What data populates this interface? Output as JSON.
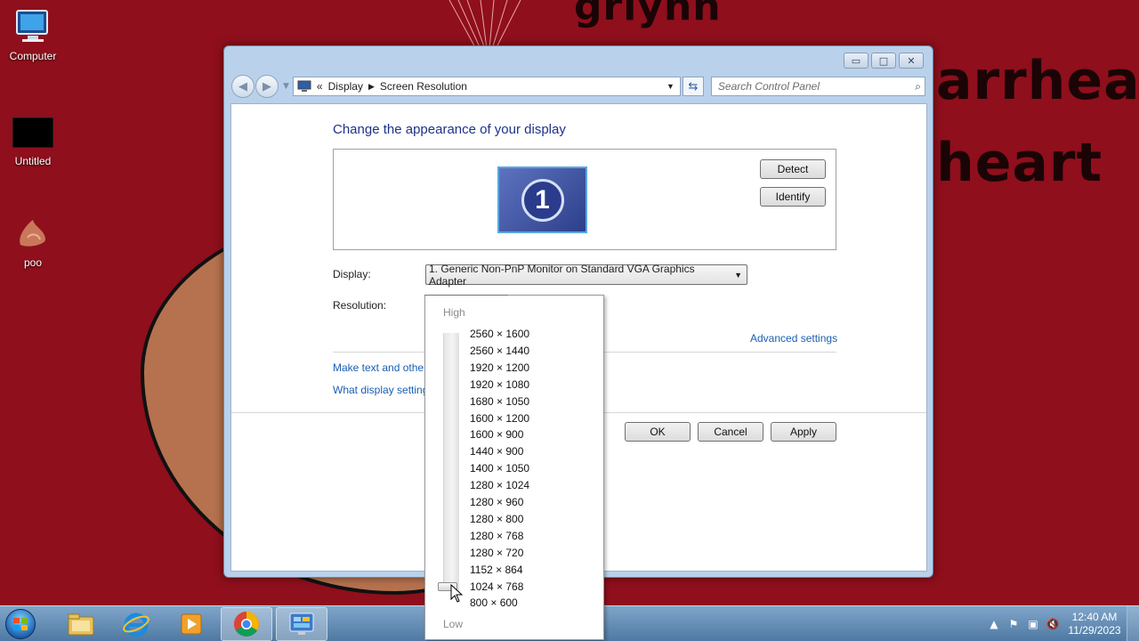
{
  "wallpaper": {
    "text_top": "griyhh",
    "text_mid": "arrhea",
    "text_bottom": "heart"
  },
  "desktop_icons": [
    {
      "label": "Computer"
    },
    {
      "label": "Untitled"
    },
    {
      "label": "poo"
    }
  ],
  "window": {
    "minimize_glyph": "▭",
    "maximize_glyph": "□",
    "close_glyph": "✕",
    "address": {
      "chevrons": "«",
      "crumbs": [
        "Display",
        "Screen Resolution"
      ]
    },
    "search_placeholder": "Search Control Panel"
  },
  "content": {
    "title": "Change the appearance of your display",
    "monitor_number": "1",
    "detect_label": "Detect",
    "identify_label": "Identify",
    "display_label": "Display:",
    "display_value": "1. Generic Non-PnP Monitor on Standard VGA Graphics Adapter",
    "resolution_label": "Resolution:",
    "advanced_link": "Advanced settings",
    "link_text_size": "Make text and other",
    "link_what_display": "What display setting",
    "ok_label": "OK",
    "cancel_label": "Cancel",
    "apply_label": "Apply"
  },
  "resolution_dropdown": {
    "high_label": "High",
    "low_label": "Low",
    "options": [
      "2560 × 1600",
      "2560 × 1440",
      "1920 × 1200",
      "1920 × 1080",
      "1680 × 1050",
      "1600 × 1200",
      "1600 × 900",
      "1440 × 900",
      "1400 × 1050",
      "1280 × 1024",
      "1280 × 960",
      "1280 × 800",
      "1280 × 768",
      "1280 × 720",
      "1152 × 864",
      "1024 × 768",
      "800 × 600"
    ],
    "selected": "1024 × 768"
  },
  "taskbar": {
    "apps": [
      "windows-explorer",
      "internet-explorer",
      "media-player",
      "chrome",
      "control-panel"
    ],
    "active_app": "control-panel",
    "clock_time": "12:40 AM",
    "clock_date": "11/29/2023"
  },
  "colors": {
    "wallpaper": "#8f0f1c",
    "link": "#1a5fb4",
    "title": "#1e3287"
  }
}
